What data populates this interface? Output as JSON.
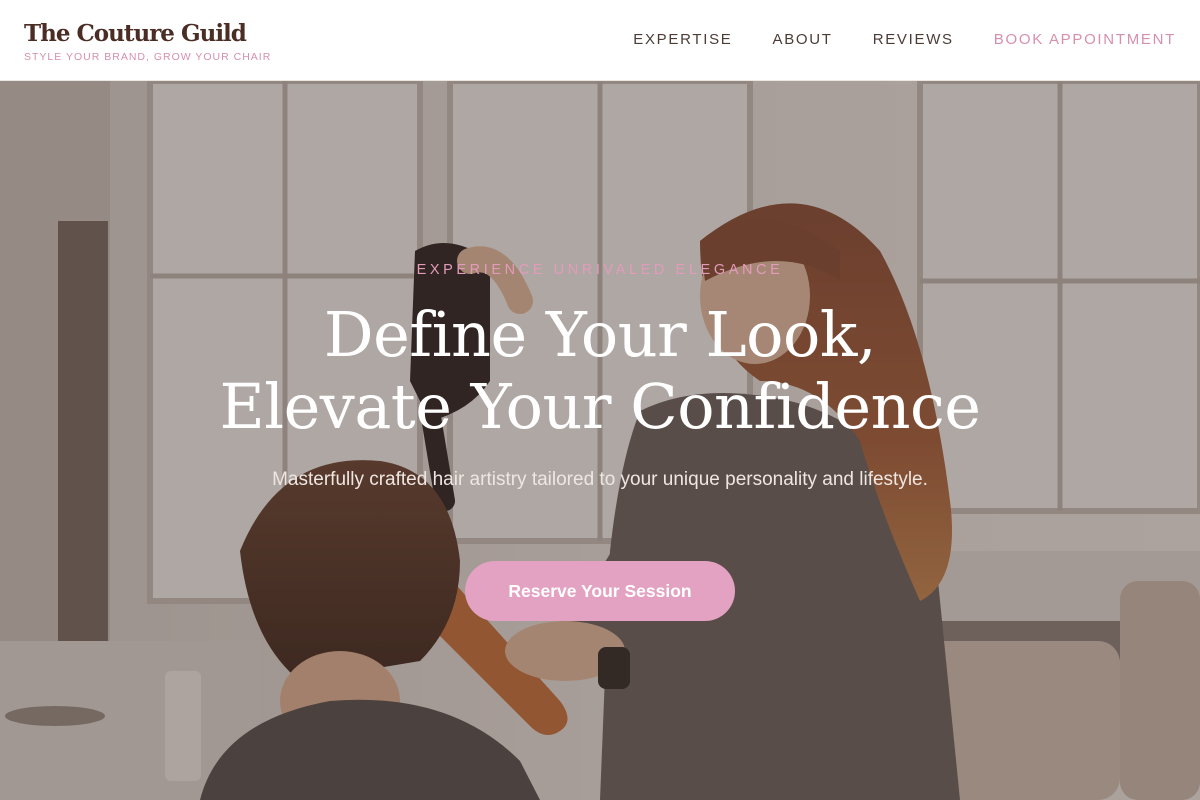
{
  "brand": {
    "name": "The Couture Guild",
    "tagline": "STYLE YOUR BRAND, GROW YOUR CHAIR"
  },
  "nav": {
    "items": [
      {
        "label": "EXPERTISE"
      },
      {
        "label": "ABOUT"
      },
      {
        "label": "REVIEWS"
      },
      {
        "label": "BOOK APPOINTMENT"
      }
    ]
  },
  "hero": {
    "eyebrow": "EXPERIENCE UNRIVALED ELEGANCE",
    "title_line1": "Define Your Look,",
    "title_line2": "Elevate Your Confidence",
    "subtitle": "Masterfully crafted hair artistry tailored to your unique personality and lifestyle.",
    "button_label": "Reserve Your Session"
  },
  "colors": {
    "brand_brown": "#4b2d25",
    "accent_pink": "#d690ad",
    "button_pink": "#e3a2c1",
    "nav_text": "#4b3c36"
  }
}
